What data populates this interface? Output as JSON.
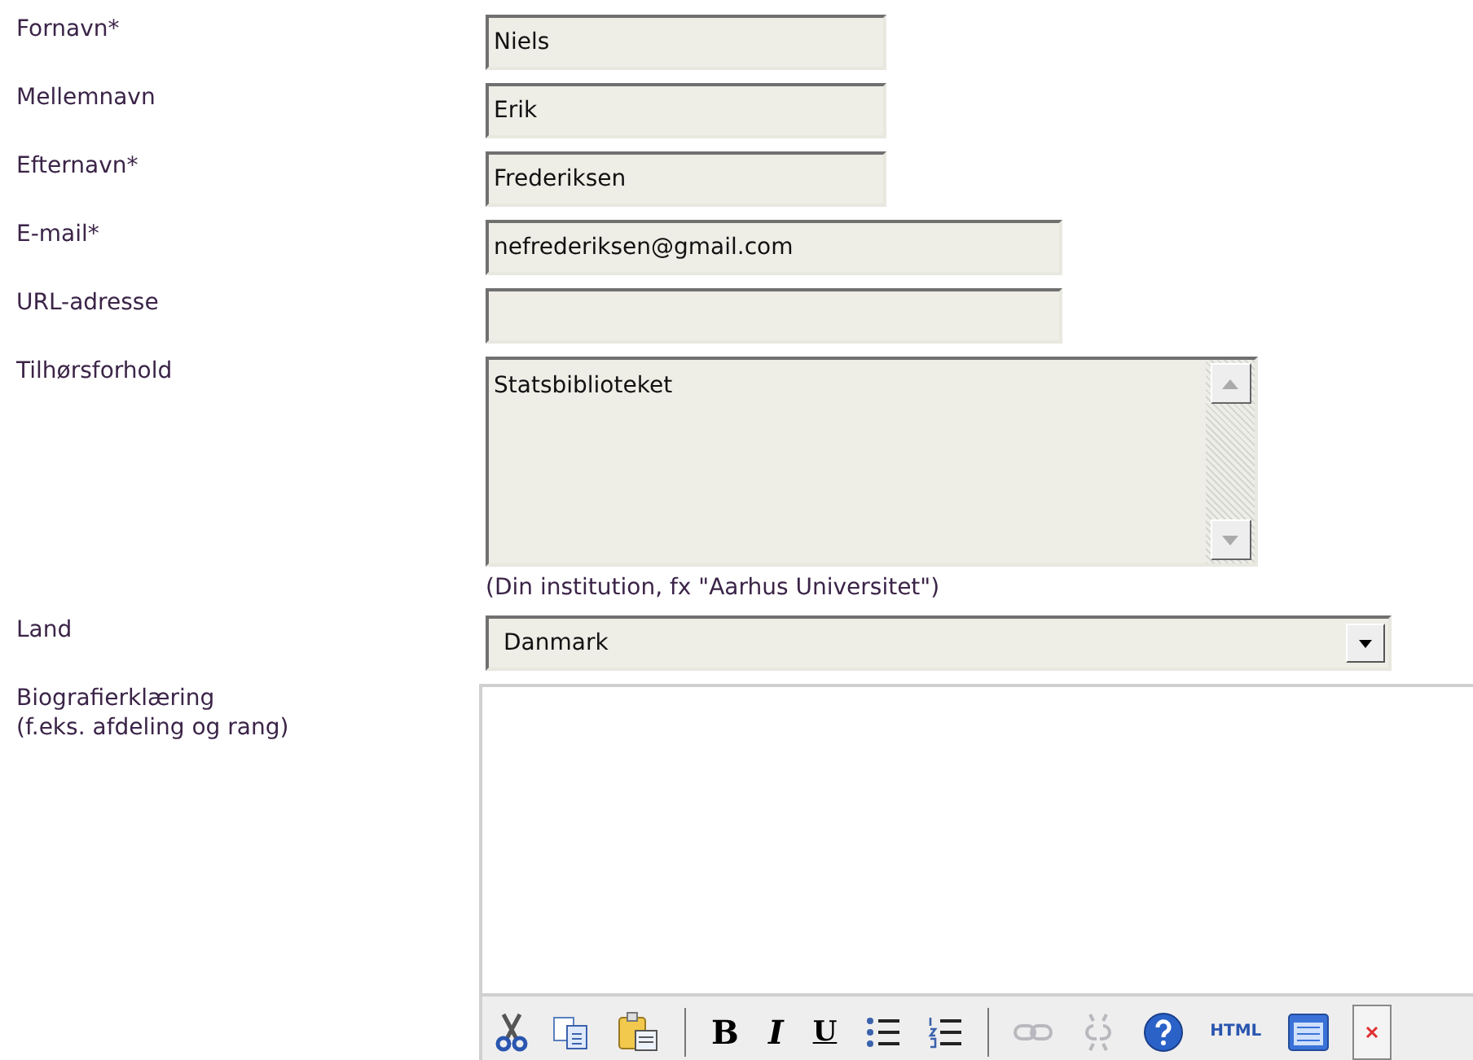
{
  "fields": [
    {
      "kind": "input",
      "label": "Fornavn*",
      "value": "Niels"
    },
    {
      "kind": "input",
      "label": "Mellemnavn",
      "value": "Erik"
    },
    {
      "kind": "input",
      "label": "Efternavn*",
      "value": "Frederiksen"
    },
    {
      "kind": "input",
      "label": "E-mail*",
      "value": "nefrederiksen@gmail.com"
    },
    {
      "kind": "input",
      "label": "URL-adresse"
    },
    {
      "kind": "textarea",
      "label": "Tilhørsforhold",
      "value": "Statsbiblioteket",
      "hint": "(Din institution, fx \"Aarhus Universitet\")"
    },
    {
      "kind": "select",
      "label": "Land",
      "value": "Danmark"
    },
    {
      "kind": "editor",
      "label": "Biografierklæring",
      "sublabel": "(f.eks. afdeling og rang)"
    }
  ],
  "toolbar": [
    {
      "kind": "cut",
      "disabled": false
    },
    {
      "kind": "copy",
      "disabled": false
    },
    {
      "kind": "paste",
      "disabled": false
    },
    {
      "kind": "separator"
    },
    {
      "kind": "bold",
      "text": "B",
      "disabled": false
    },
    {
      "kind": "italic",
      "text": "I",
      "disabled": false
    },
    {
      "kind": "underline",
      "text": "U",
      "disabled": false
    },
    {
      "kind": "bullets",
      "disabled": false
    },
    {
      "kind": "numbers",
      "disabled": false
    },
    {
      "kind": "separator"
    },
    {
      "kind": "link",
      "disabled": true
    },
    {
      "kind": "unlink",
      "disabled": true
    },
    {
      "kind": "help",
      "disabled": false
    },
    {
      "kind": "html",
      "text": "HTML",
      "disabled": false
    },
    {
      "kind": "fullscreen",
      "disabled": false
    },
    {
      "kind": "close",
      "disabled": false
    }
  ]
}
